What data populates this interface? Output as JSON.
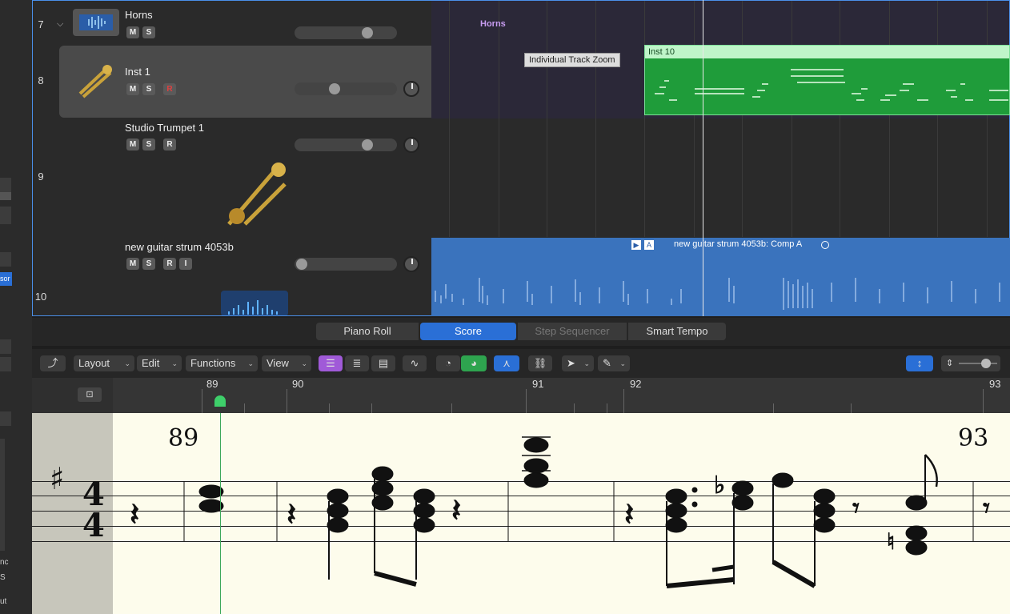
{
  "tracks": [
    {
      "number": "7",
      "name": "Horns",
      "buttons": [
        "M",
        "S"
      ]
    },
    {
      "number": "8",
      "name": "Inst 1",
      "buttons": [
        "M",
        "S",
        "R"
      ]
    },
    {
      "number": "9",
      "name": "Studio Trumpet 1",
      "buttons": [
        "M",
        "S",
        "R"
      ]
    },
    {
      "number": "10",
      "name": "new guitar strum 4053b",
      "buttons": [
        "M",
        "S",
        "R",
        "I"
      ]
    }
  ],
  "regions": {
    "horns_label": "Horns",
    "tooltip": "Individual Track Zoom",
    "inst10": "Inst 10",
    "audio_label": "new guitar strum 4053b: Comp A",
    "audio_badges": [
      "▶",
      "A"
    ]
  },
  "inspector": {
    "selected_text": "sor",
    "labels": [
      "nc",
      "S",
      "ut"
    ]
  },
  "editor_tabs": [
    {
      "label": "Piano Roll",
      "state": "normal"
    },
    {
      "label": "Score",
      "state": "active"
    },
    {
      "label": "Step Sequencer",
      "state": "disabled"
    },
    {
      "label": "Smart Tempo",
      "state": "normal"
    }
  ],
  "toolbar": {
    "menus": [
      "Layout",
      "Edit",
      "Functions",
      "View"
    ],
    "icons": [
      "up-arrow-icon",
      "linear-view-icon",
      "page-view-icon",
      "print-view-icon",
      "curve-icon",
      "midi-in-icon",
      "midi-out-icon",
      "catch-icon",
      "link-icon",
      "pointer-tool-icon",
      "pencil-tool-icon",
      "vertical-zoom-icon",
      "zoom-slider"
    ]
  },
  "ruler": {
    "bars": [
      "89",
      "90",
      "91",
      "92",
      "93"
    ]
  },
  "score": {
    "measure_numbers": [
      "89",
      "93"
    ],
    "time_signature": [
      "4",
      "4"
    ]
  },
  "colors": {
    "selection": "#2a6fd6",
    "midi_region": "#1f9c3a",
    "audio_region": "#3a73bd",
    "score_bg": "#fdfcec",
    "playhead_green": "#3ecf6a"
  }
}
